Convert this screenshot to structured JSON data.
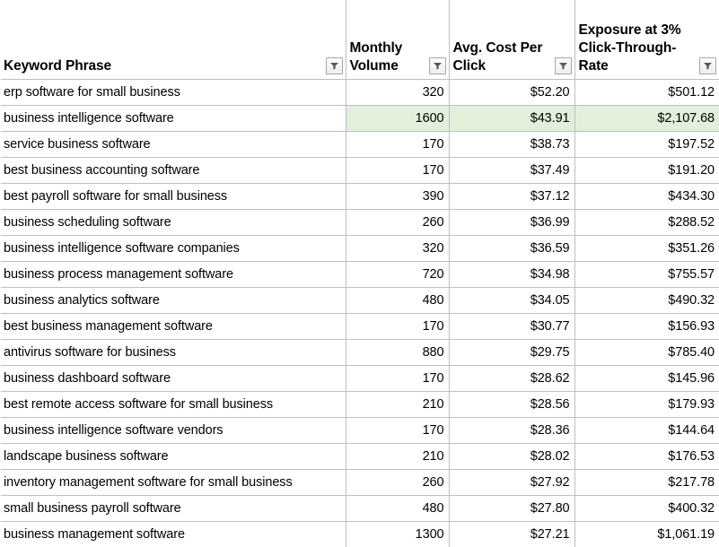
{
  "table": {
    "columns": [
      {
        "key": "keyword",
        "label": "Keyword Phrase",
        "align": "left",
        "filter_icon": "filter-dropdown-icon"
      },
      {
        "key": "volume",
        "label": "Monthly Volume",
        "align": "right",
        "filter_icon": "filter-dropdown-icon"
      },
      {
        "key": "cpc",
        "label": "Avg. Cost Per Click",
        "align": "right",
        "filter_icon": "filter-dropdown-icon"
      },
      {
        "key": "exposure",
        "label": "Exposure at 3% Click-Through-Rate",
        "align": "right",
        "filter_icon": "filter-dropdown-icon"
      }
    ],
    "highlight_color": "#e2efda",
    "gridline_color": "#bfbfbf",
    "highlighted_row_index": 1,
    "rows": [
      {
        "keyword": "erp software for small business",
        "volume": "320",
        "cpc": "$52.20",
        "exposure": "$501.12",
        "highlighted": false,
        "clipped": false
      },
      {
        "keyword": "business intelligence software",
        "volume": "1600",
        "cpc": "$43.91",
        "exposure": "$2,107.68",
        "highlighted": true,
        "clipped": false
      },
      {
        "keyword": "service business software",
        "volume": "170",
        "cpc": "$38.73",
        "exposure": "$197.52",
        "highlighted": false,
        "clipped": false
      },
      {
        "keyword": "best business accounting software",
        "volume": "170",
        "cpc": "$37.49",
        "exposure": "$191.20",
        "highlighted": false,
        "clipped": false
      },
      {
        "keyword": "best payroll software for small business",
        "volume": "390",
        "cpc": "$37.12",
        "exposure": "$434.30",
        "highlighted": false,
        "clipped": false
      },
      {
        "keyword": "business scheduling software",
        "volume": "260",
        "cpc": "$36.99",
        "exposure": "$288.52",
        "highlighted": false,
        "clipped": false
      },
      {
        "keyword": "business intelligence software companies",
        "volume": "320",
        "cpc": "$36.59",
        "exposure": "$351.26",
        "highlighted": false,
        "clipped": false
      },
      {
        "keyword": "business process management software",
        "volume": "720",
        "cpc": "$34.98",
        "exposure": "$755.57",
        "highlighted": false,
        "clipped": false
      },
      {
        "keyword": "business analytics software",
        "volume": "480",
        "cpc": "$34.05",
        "exposure": "$490.32",
        "highlighted": false,
        "clipped": false
      },
      {
        "keyword": "best business management software",
        "volume": "170",
        "cpc": "$30.77",
        "exposure": "$156.93",
        "highlighted": false,
        "clipped": false
      },
      {
        "keyword": "antivirus software for business",
        "volume": "880",
        "cpc": "$29.75",
        "exposure": "$785.40",
        "highlighted": false,
        "clipped": false
      },
      {
        "keyword": "business dashboard software",
        "volume": "170",
        "cpc": "$28.62",
        "exposure": "$145.96",
        "highlighted": false,
        "clipped": false
      },
      {
        "keyword": "best remote access software for small business",
        "volume": "210",
        "cpc": "$28.56",
        "exposure": "$179.93",
        "highlighted": false,
        "clipped": true
      },
      {
        "keyword": "business intelligence software vendors",
        "volume": "170",
        "cpc": "$28.36",
        "exposure": "$144.64",
        "highlighted": false,
        "clipped": false
      },
      {
        "keyword": "landscape business software",
        "volume": "210",
        "cpc": "$28.02",
        "exposure": "$176.53",
        "highlighted": false,
        "clipped": false
      },
      {
        "keyword": "inventory management software for small business",
        "volume": "260",
        "cpc": "$27.92",
        "exposure": "$217.78",
        "highlighted": false,
        "clipped": true
      },
      {
        "keyword": "small business payroll software",
        "volume": "480",
        "cpc": "$27.80",
        "exposure": "$400.32",
        "highlighted": false,
        "clipped": false
      },
      {
        "keyword": "business management software",
        "volume": "1300",
        "cpc": "$27.21",
        "exposure": "$1,061.19",
        "highlighted": false,
        "clipped": false
      }
    ]
  }
}
